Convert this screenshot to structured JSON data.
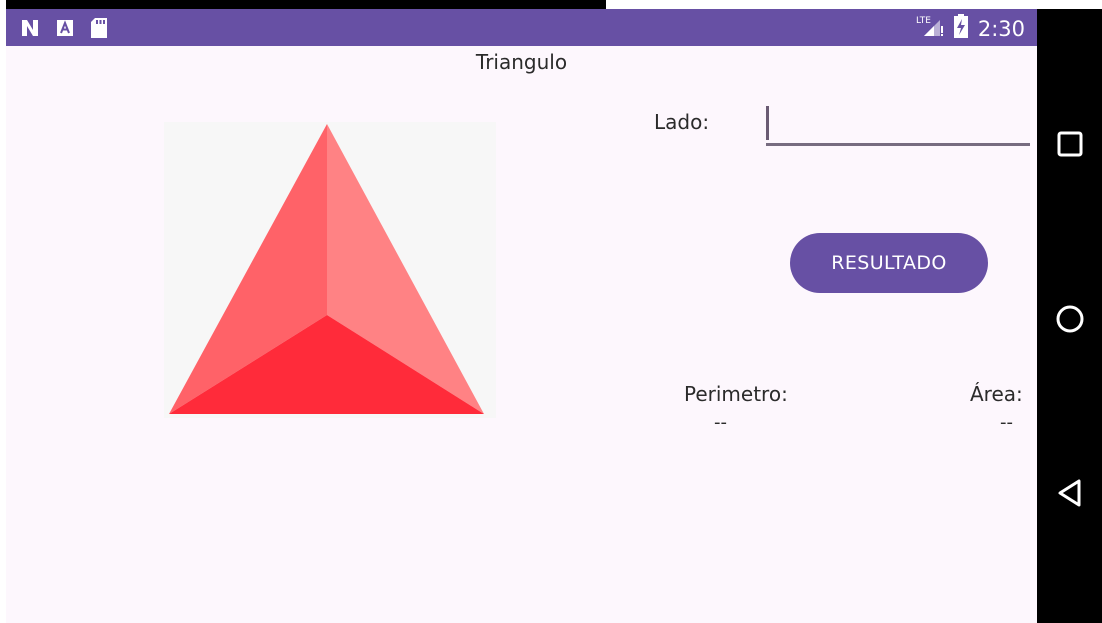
{
  "status_bar": {
    "time": "2:30",
    "network": "LTE",
    "left_icons": [
      "n-icon",
      "a-icon",
      "sd-card-icon"
    ],
    "right_icons": [
      "lte-signal-icon",
      "battery-charging-icon"
    ]
  },
  "app": {
    "title": "Triangulo",
    "lado_label": "Lado:",
    "lado_value": "",
    "button_label": "RESULTADO",
    "perimetro_label": "Perimetro:",
    "perimetro_value": "--",
    "area_label": "Área:",
    "area_value": "--"
  },
  "colors": {
    "primary": "#6750a4",
    "background": "#fdf7fd",
    "triangle_left": "#ff6268",
    "triangle_right": "#ff8284",
    "triangle_bottom": "#ff2b3a"
  },
  "nav_bar": {
    "buttons": [
      "recents-square-icon",
      "home-circle-icon",
      "back-triangle-icon"
    ]
  }
}
